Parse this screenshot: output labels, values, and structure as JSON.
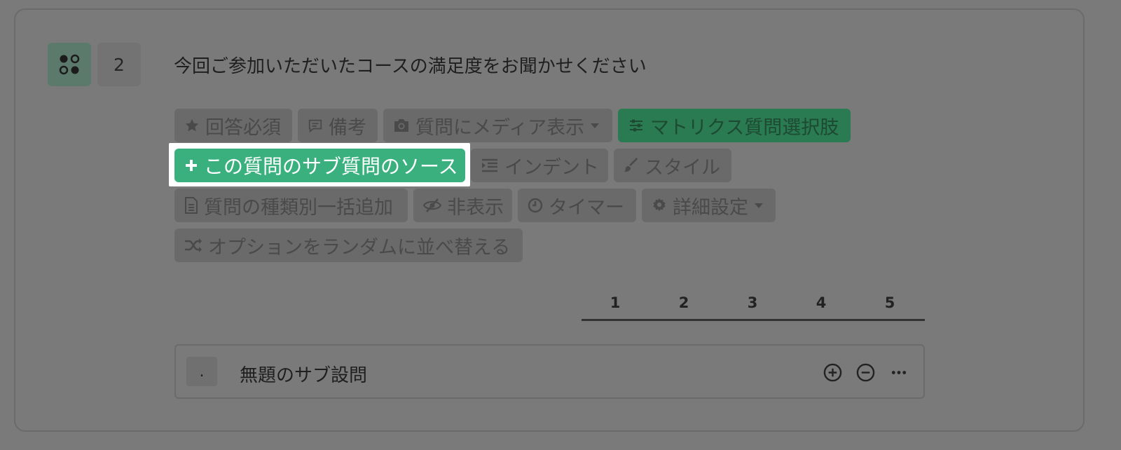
{
  "question": {
    "number": "2",
    "title": "今回ご参加いただいたコースの満足度をお聞かせください"
  },
  "toolbar": {
    "required": "回答必須",
    "note": "備考",
    "media": "質問にメディア表示",
    "matrix": "マトリクス質問選択肢",
    "sub_source": "この質問のサブ質問のソース",
    "indent": "インデント",
    "style": "スタイル",
    "bulk_add": "質問の種類別一括追加",
    "hide": "非表示",
    "timer": "タイマー",
    "advanced": "詳細設定",
    "randomize": "オプションをランダムに並べ替える"
  },
  "scale": [
    "1",
    "2",
    "3",
    "4",
    "5"
  ],
  "sub_question": {
    "marker": ".",
    "title": "無題のサブ設問"
  }
}
